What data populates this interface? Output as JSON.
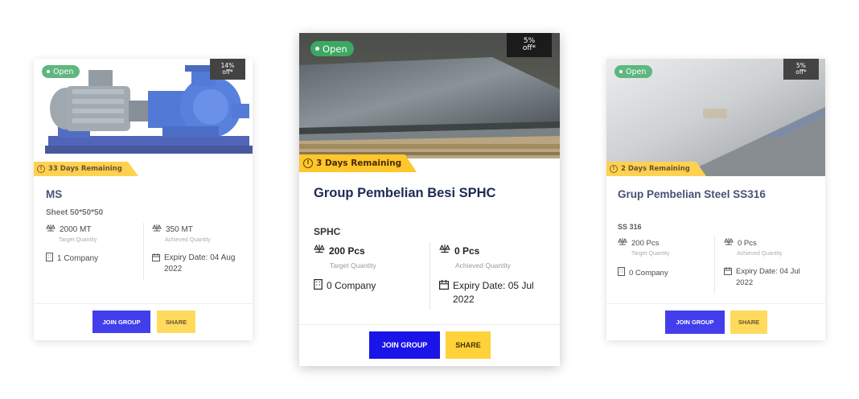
{
  "cards": [
    {
      "status": "Open",
      "discount": "14%\noff*",
      "remaining": "33 Days Remaining",
      "title": "MS",
      "subtitle": "Sheet 50*50*50",
      "target_value": "2000 MT",
      "target_label": "Target Quantity",
      "achieved_value": "350 MT",
      "achieved_label": "Achieved Quantity",
      "company": "1 Company",
      "expiry": "Expiry Date: 04 Aug 2022",
      "join_label": "JOIN GROUP",
      "share_label": "SHARE"
    },
    {
      "status": "Open",
      "discount": "5%\noff*",
      "remaining": "3 Days Remaining",
      "title": "Group Pembelian Besi SPHC",
      "subtitle": "SPHC",
      "target_value": "200 Pcs",
      "target_label": "Target Quantity",
      "achieved_value": "0 Pcs",
      "achieved_label": "Achieved Quantity",
      "company": "0 Company",
      "expiry": "Expiry Date: 05 Jul 2022",
      "join_label": "JOIN GROUP",
      "share_label": "SHARE"
    },
    {
      "status": "Open",
      "discount": "5%\noff*",
      "remaining": "2 Days Remaining",
      "title": "Grup Pembelian Steel SS316",
      "subtitle": "SS 316",
      "target_value": "200 Pcs",
      "target_label": "Target Quantity",
      "achieved_value": "0 Pcs",
      "achieved_label": "Achieved Quantity",
      "company": "0 Company",
      "expiry": "Expiry Date: 04 Jul 2022",
      "join_label": "JOIN GROUP",
      "share_label": "SHARE"
    }
  ],
  "colors": {
    "join_button": "#1a14e8",
    "share_button": "#ffd23a",
    "open_status": "#3da862",
    "ribbon": "#ffc72c",
    "title": "#1d2a55"
  },
  "icons": {
    "target": "scale-icon",
    "achieved": "scale-icon",
    "company": "building-icon",
    "expiry": "calendar-icon",
    "remaining": "clock-icon"
  }
}
